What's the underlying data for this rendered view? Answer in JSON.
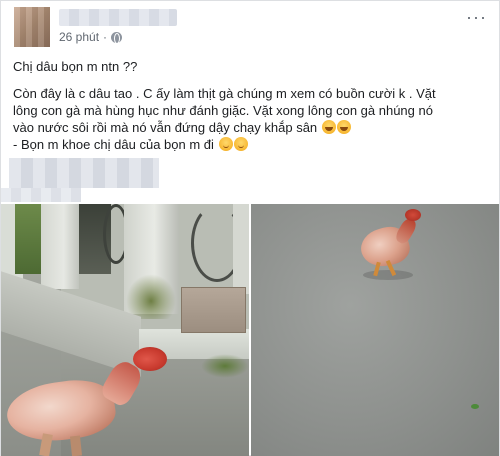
{
  "post": {
    "timestamp": "26 phút",
    "more_label": "···",
    "line1": "Chị dâu bọn m ntn ??",
    "line2a": "Còn đây là c dâu tao . C ấy làm thịt gà chúng m xem có buồn cười k . Vặt",
    "line2b": "lông con gà mà hùng hục như đánh giặc. Vặt xong lông con gà nhúng nó",
    "line2c": "vào nước sôi rồi mà nó vẫn đứng dậy chạy khắp sân",
    "line3": "- Bọn m khoe chị dâu của bọn m đi",
    "emoji_line2": [
      "rolling-on-floor-laughing",
      "rolling-on-floor-laughing"
    ],
    "emoji_line3": [
      "relieved-face",
      "relieved-face"
    ]
  },
  "colors": {
    "text": "#1c1e21",
    "meta": "#606770",
    "border": "#dddfe2"
  }
}
